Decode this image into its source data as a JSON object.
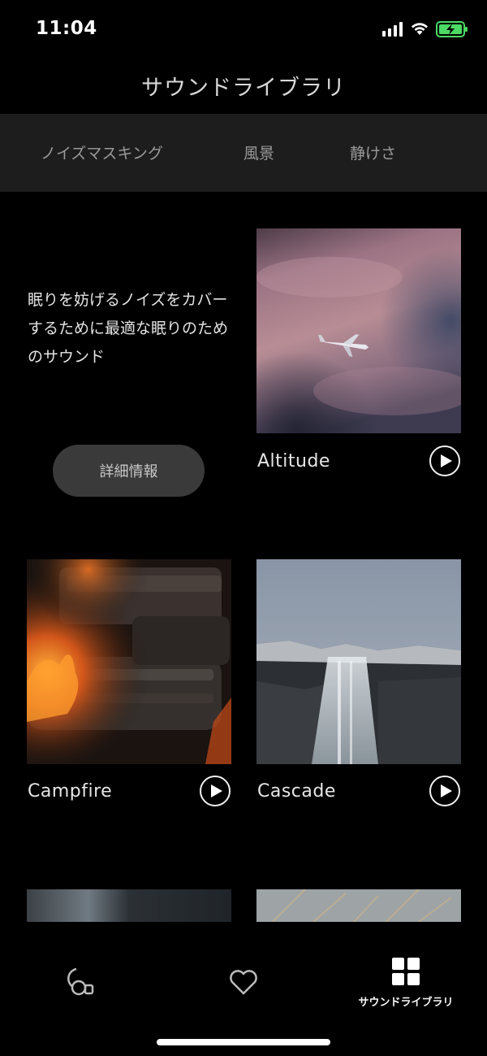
{
  "status_bar": {
    "time": "11:04",
    "icons": [
      "signal-icon",
      "wifi-icon",
      "battery-charging-icon"
    ]
  },
  "header": {
    "title": "サウンドライブラリ"
  },
  "tabs": [
    {
      "label": "ノイズマスキング"
    },
    {
      "label": "風景"
    },
    {
      "label": "静けさ"
    }
  ],
  "intro": {
    "text": "眠りを妨げるノイズをカバーするために最適な眠りのためのサウンド",
    "button_label": "詳細情報"
  },
  "sounds": [
    {
      "title": "Altitude",
      "image": "airplane-in-clouds"
    },
    {
      "title": "Campfire",
      "image": "burning-logs"
    },
    {
      "title": "Cascade",
      "image": "waterfall-cliff"
    }
  ],
  "partial_cards": [
    {
      "image": "blurred-water"
    },
    {
      "image": "grass-sky"
    }
  ],
  "bottom_nav": {
    "items": [
      {
        "icon": "earbuds-icon",
        "label": ""
      },
      {
        "icon": "heart-icon",
        "label": ""
      },
      {
        "icon": "grid-icon",
        "label": "サウンドライブラリ",
        "active": true
      }
    ]
  },
  "colors": {
    "background": "#000000",
    "tab_bar": "#1d1d1d",
    "button": "#3a3a3a",
    "battery": "#4cd964"
  }
}
